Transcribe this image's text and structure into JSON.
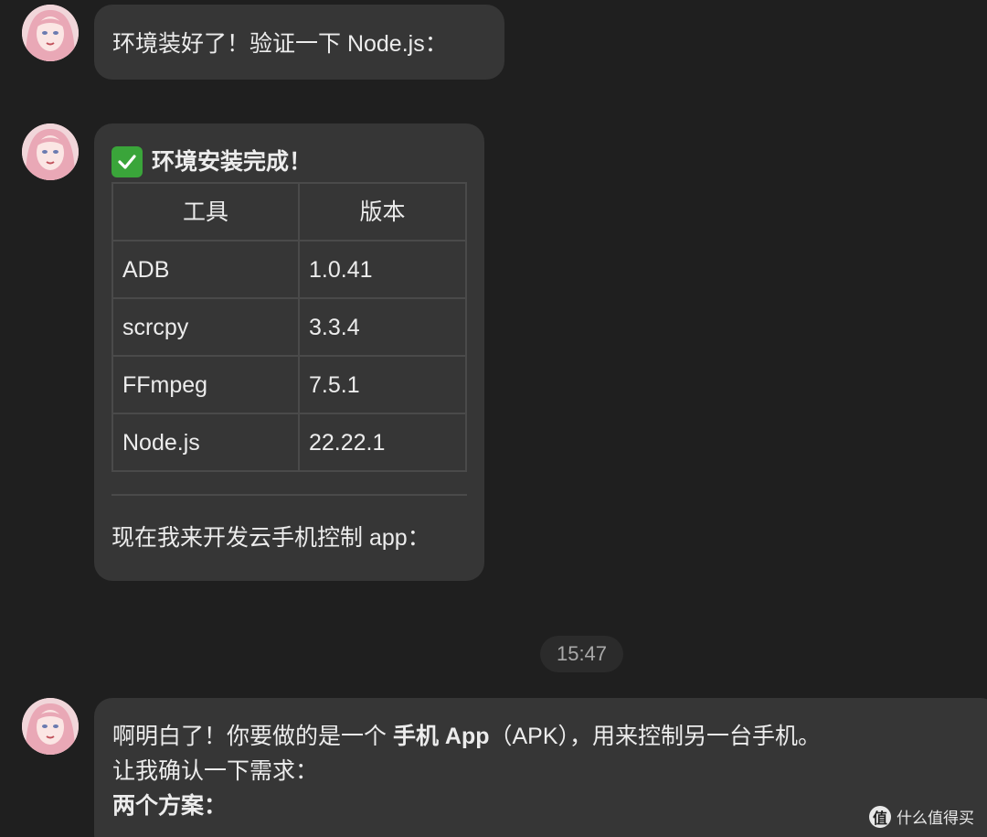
{
  "messages": [
    {
      "text": "环境装好了！验证一下 Node.js："
    },
    {
      "heading_icon": "check-mark-icon",
      "heading": "环境安装完成！",
      "table": {
        "headers": [
          "工具",
          "版本"
        ],
        "rows": [
          [
            "ADB",
            "1.0.41"
          ],
          [
            "scrcpy",
            "3.3.4"
          ],
          [
            "FFmpeg",
            "7.5.1"
          ],
          [
            "Node.js",
            "22.22.1"
          ]
        ]
      },
      "after_text": "现在我来开发云手机控制 app："
    },
    {
      "line1_pre": "啊明白了！你要做的是一个 ",
      "line1_bold": "手机 App",
      "line1_post": "（APK），用来控制另一台手机。",
      "line2": "让我确认一下需求：",
      "line3_bold": "两个方案："
    }
  ],
  "timestamp": "15:47",
  "watermark": {
    "icon_glyph": "值",
    "text": "什么值得买"
  },
  "colors": {
    "background": "#1f1f1f",
    "bubble": "#363636",
    "check": "#3aa53a"
  }
}
